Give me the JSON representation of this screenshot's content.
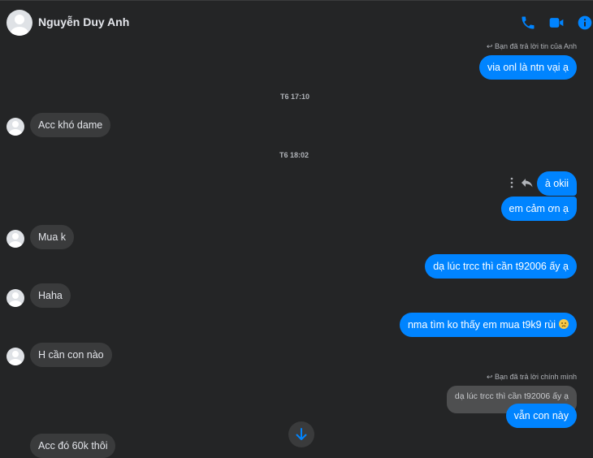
{
  "header": {
    "contact_name": "Nguyễn Duy Anh",
    "icons": [
      "phone-icon",
      "video-call-icon",
      "info-icon"
    ],
    "accent_color": "#0084ff"
  },
  "messages": {
    "reply_note_1": "Bạn đã trả lời tin của Anh",
    "m1": "via onl là ntn vại ạ",
    "ts1": "T6 17:10",
    "m2": "Acc khó dame",
    "ts2": "T6 18:02",
    "m3": "à okii",
    "m4": "em cảm ơn ạ",
    "m5": "Mua k",
    "m6": "dạ lúc trcc thì cần t92006 ấy ạ",
    "m7": "Haha",
    "m8": "nma tìm ko thấy em mua t9k9 rùi",
    "m9": "H cần con nào",
    "reply_note_2": "Bạn đã trả lời chính mình",
    "quoted_2": "dạ lúc trcc thì cần t92006 ấy ạ",
    "m10": "vẫn con này",
    "m11": "Acc đó 60k thôi"
  }
}
